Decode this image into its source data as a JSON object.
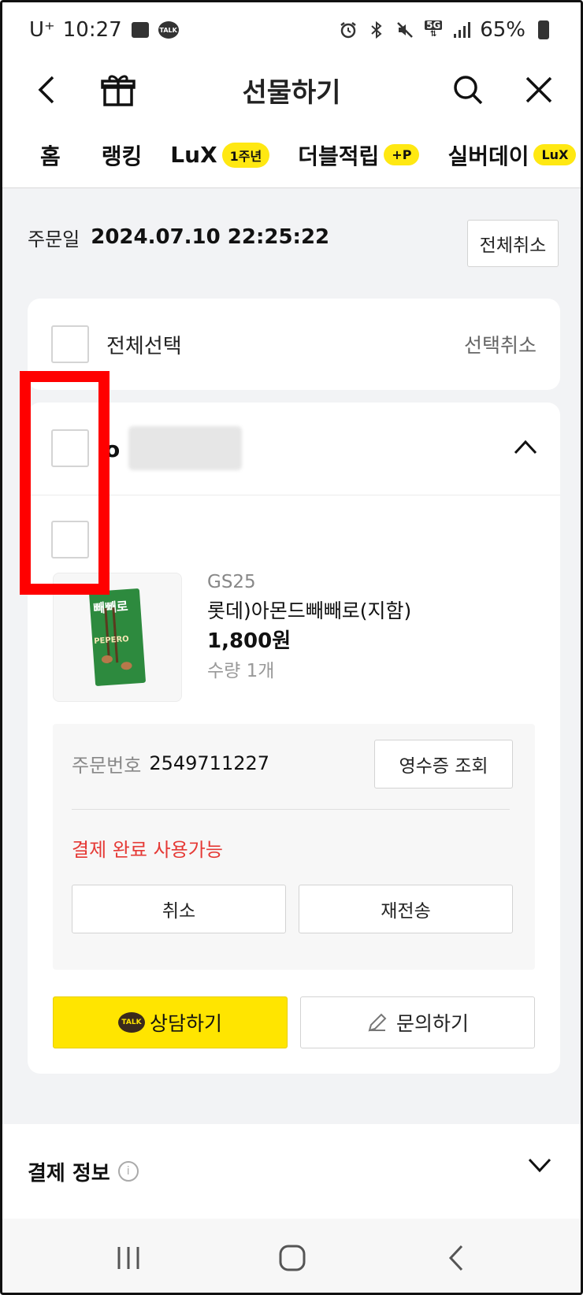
{
  "status_bar": {
    "carrier": "U⁺",
    "time": "10:27",
    "network": "5G",
    "battery": "65%"
  },
  "header": {
    "title": "선물하기"
  },
  "tabs": [
    {
      "label": "홈",
      "badge": ""
    },
    {
      "label": "랭킹",
      "badge": ""
    },
    {
      "label": "LuX",
      "badge": "1주년"
    },
    {
      "label": "더블적립",
      "badge": "+P"
    },
    {
      "label": "실버데이",
      "badge": "LuX"
    }
  ],
  "order": {
    "date_label": "주문일",
    "date_value": "2024.07.10 22:25:22",
    "cancel_all_label": "전체취소"
  },
  "select_all": {
    "label": "전체선택",
    "deselect_label": "선택취소"
  },
  "product_card": {
    "recipient_initial": "o",
    "brand": "GS25",
    "name": "롯데)아몬드빼빼로(지함)",
    "price": "1,800원",
    "quantity": "수량 1개",
    "thumbnail_text_top": "빼빼로",
    "thumbnail_text_mid": "PEPERO",
    "order_no_label": "주문번호",
    "order_no_value": "2549711227",
    "receipt_label": "영수증 조회",
    "status": "결제 완료 사용가능",
    "cancel_label": "취소",
    "resend_label": "재전송",
    "consult_label": "상담하기",
    "consult_icon_text": "TALK",
    "inquiry_label": "문의하기"
  },
  "payment": {
    "title": "결제 정보"
  },
  "colors": {
    "accent_yellow": "#ffe500",
    "status_red": "#e53935",
    "highlight_red": "#ff0000"
  }
}
